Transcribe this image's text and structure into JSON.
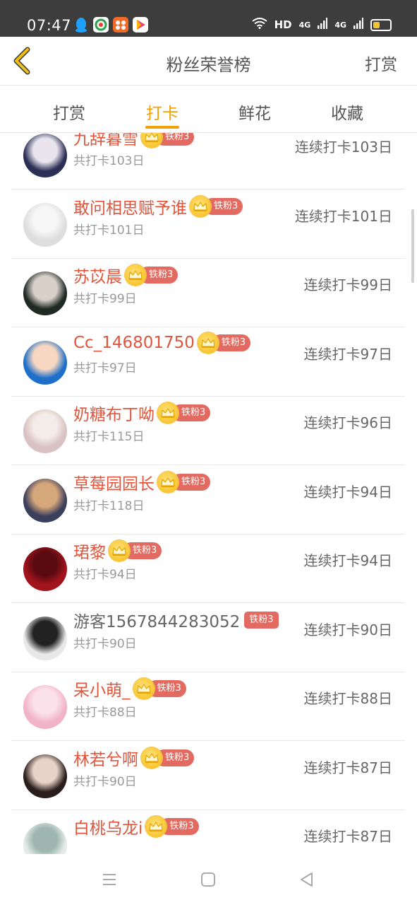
{
  "status_bar": {
    "time": "07:47",
    "network": "HD",
    "signal1": "4G",
    "signal2": "4G"
  },
  "header": {
    "title": "粉丝荣誉榜",
    "right_action": "打赏"
  },
  "tabs": [
    {
      "label": "打赏",
      "active": false
    },
    {
      "label": "打卡",
      "active": true
    },
    {
      "label": "鲜花",
      "active": false
    },
    {
      "label": "收藏",
      "active": false
    }
  ],
  "fans": [
    {
      "name": "九辞暮雪",
      "badge": "铁粉3",
      "total": "共打卡103日",
      "streak": "连续打卡103日",
      "crown": true
    },
    {
      "name": "敢问相思赋予谁",
      "badge": "铁粉3",
      "total": "共打卡101日",
      "streak": "连续打卡101日",
      "crown": true
    },
    {
      "name": "苏苡晨",
      "badge": "铁粉3",
      "total": "共打卡99日",
      "streak": "连续打卡99日",
      "crown": true
    },
    {
      "name": "Cc_146801750",
      "badge": "铁粉3",
      "total": "共打卡97日",
      "streak": "连续打卡97日",
      "crown": true
    },
    {
      "name": "奶糖布丁呦",
      "badge": "铁粉3",
      "total": "共打卡115日",
      "streak": "连续打卡96日",
      "crown": true
    },
    {
      "name": "草莓园园长",
      "badge": "铁粉3",
      "total": "共打卡118日",
      "streak": "连续打卡94日",
      "crown": true
    },
    {
      "name": "珺黎",
      "badge": "铁粉3",
      "total": "共打卡94日",
      "streak": "连续打卡94日",
      "crown": true
    },
    {
      "name": "游客1567844283052",
      "badge": "铁粉3",
      "total": "共打卡90日",
      "streak": "连续打卡90日",
      "crown": false
    },
    {
      "name": "呆小萌_",
      "badge": "铁粉3",
      "total": "共打卡88日",
      "streak": "连续打卡88日",
      "crown": true
    },
    {
      "name": "林若兮啊",
      "badge": "铁粉3",
      "total": "共打卡90日",
      "streak": "连续打卡87日",
      "crown": true
    },
    {
      "name": "白桃乌龙i",
      "badge": "铁粉3",
      "total": "",
      "streak": "连续打卡87日",
      "crown": true
    }
  ],
  "colors": {
    "accent": "#f2a104",
    "name": "#e0553c",
    "badge": "#e36a61"
  }
}
